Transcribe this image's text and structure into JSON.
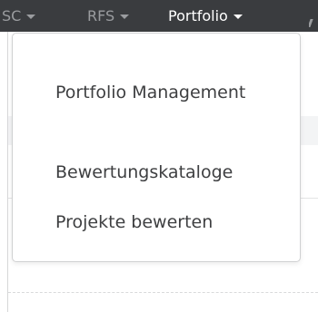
{
  "navbar": {
    "items": [
      {
        "label": "SC"
      },
      {
        "label": "RFS"
      },
      {
        "label": "Portfolio"
      }
    ]
  },
  "dropdown": {
    "items": [
      {
        "label": "Portfolio Management"
      },
      {
        "label": "Bewertungskataloge"
      },
      {
        "label": "Projekte bewerten"
      }
    ]
  }
}
